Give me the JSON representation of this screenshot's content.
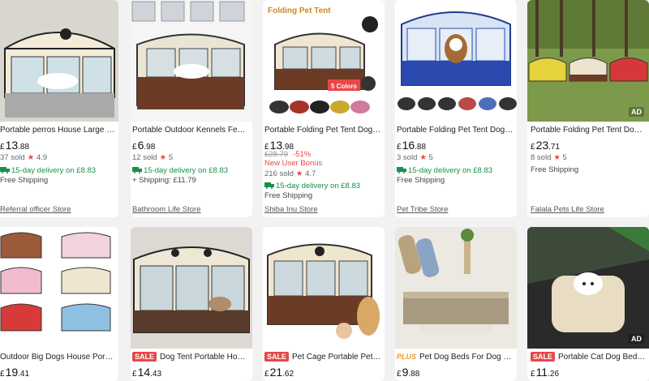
{
  "currency": "£",
  "colors": {
    "accent": "#e7474a",
    "delivery": "#1a8f4a",
    "plus": "#e99a2b"
  },
  "products": [
    {
      "title": "Portable perros House Large Small…",
      "price_int": "13",
      "price_dec": ".88",
      "sold": "37 sold",
      "rating": "4.9",
      "delivery": "15-day delivery on £8.83",
      "shipping": "Free Shipping",
      "store": "Referral officer Store"
    },
    {
      "title": "Portable Outdoor Kennels Fences …",
      "price_int": "6",
      "price_dec": ".98",
      "sold": "12 sold",
      "rating": "5",
      "delivery": "15-day delivery on £8.83",
      "shipping": "+ Shipping: £11.79",
      "store": "Bathroom Life Store"
    },
    {
      "title": "Portable Folding Pet Tent Dog Hou…",
      "price_int": "13",
      "price_dec": ".98",
      "orig_price": "£28.79",
      "discount": "-51%",
      "bonus": "New User Bonus",
      "sold": "216 sold",
      "rating": "4.7",
      "delivery": "15-day delivery on £8.83",
      "shipping": "Free Shipping",
      "store": "Shiba Inu Store",
      "img_banner": "Folding Pet Tent",
      "img_colors": "5 Colors"
    },
    {
      "title": "Portable Folding Pet Tent Dog Hou…",
      "price_int": "16",
      "price_dec": ".88",
      "sold": "3 sold",
      "rating": "5",
      "delivery": "15-day delivery on £8.83",
      "shipping": "Free Shipping",
      "store": "Pet Tribe Store"
    },
    {
      "title": "Portable Folding Pet Tent Dog Hou…",
      "price_int": "23",
      "price_dec": ".71",
      "sold": "8 sold",
      "rating": "5",
      "shipping": "Free Shipping",
      "store": "Falala Pets Life Store",
      "ad": "AD"
    },
    {
      "title": "Outdoor Big Dogs House Portable …",
      "price_int": "19",
      "price_dec": ".41"
    },
    {
      "title": "Dog Tent Portable House B…",
      "price_int": "14",
      "price_dec": ".43",
      "tag": "SALE"
    },
    {
      "title": "Pet Cage Portable Pet Tent …",
      "price_int": "21",
      "price_dec": ".62",
      "tag": "SALE"
    },
    {
      "title": "Pet Dog Beds For Dog Fold…",
      "price_int": "9",
      "price_dec": ".88",
      "tag": "PLUS"
    },
    {
      "title": "Portable Cat Dog Bed Trav…",
      "price_int": "11",
      "price_dec": ".26",
      "tag": "SALE",
      "ad": "AD"
    }
  ]
}
